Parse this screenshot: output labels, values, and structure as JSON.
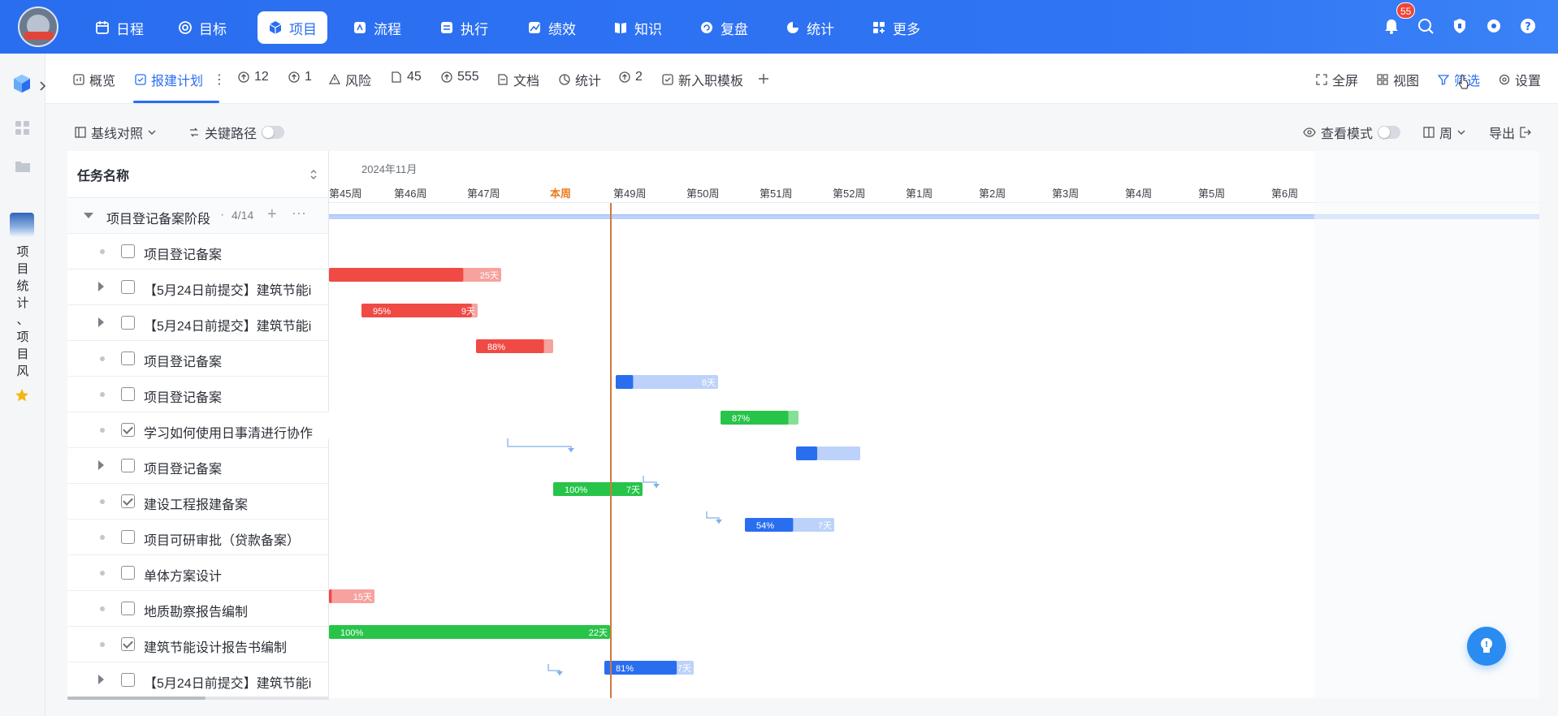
{
  "nav": {
    "items": [
      {
        "label": "日程",
        "icon": "calendar-icon"
      },
      {
        "label": "目标",
        "icon": "target-icon"
      },
      {
        "label": "项目",
        "icon": "cube-icon",
        "active": true
      },
      {
        "label": "流程",
        "icon": "flow-icon"
      },
      {
        "label": "执行",
        "icon": "list-icon"
      },
      {
        "label": "绩效",
        "icon": "chart-icon"
      },
      {
        "label": "知识",
        "icon": "book-icon"
      },
      {
        "label": "复盘",
        "icon": "review-icon"
      },
      {
        "label": "统计",
        "icon": "pie-icon"
      },
      {
        "label": "更多",
        "icon": "grid-plus-icon"
      }
    ],
    "notification_count": "55"
  },
  "rail": {
    "project_name": "项目统计、项目风"
  },
  "tabs": {
    "items": [
      {
        "label": "概览"
      },
      {
        "label": "报建计划",
        "active": true
      },
      {
        "label": "12"
      },
      {
        "label": "1"
      },
      {
        "label": "风险"
      },
      {
        "label": "45"
      },
      {
        "label": "555"
      },
      {
        "label": "文档"
      },
      {
        "label": "统计"
      },
      {
        "label": "2"
      },
      {
        "label": "新入职模板"
      }
    ],
    "right": {
      "fullscreen": "全屏",
      "view": "视图",
      "filter": "筛选",
      "settings": "设置"
    }
  },
  "toolbar": {
    "baseline": "基线对照",
    "critical_path": "关键路径",
    "view_mode": "查看模式",
    "scale": "周",
    "export": "导出"
  },
  "tasklist": {
    "header": "任务名称",
    "group": {
      "name": "项目登记备案阶段",
      "count": "4/14"
    },
    "rows": [
      {
        "name": "项目登记备案",
        "expand": false,
        "checked": false
      },
      {
        "name": "【5月24日前提交】建筑节能i",
        "expand": true,
        "checked": false
      },
      {
        "name": "【5月24日前提交】建筑节能i",
        "expand": true,
        "checked": false
      },
      {
        "name": "项目登记备案",
        "expand": false,
        "checked": false
      },
      {
        "name": "项目登记备案",
        "expand": false,
        "checked": false
      },
      {
        "name": "学习如何使用日事清进行协作",
        "expand": false,
        "checked": true
      },
      {
        "name": "项目登记备案",
        "expand": true,
        "checked": false
      },
      {
        "name": "建设工程报建备案",
        "expand": false,
        "checked": true
      },
      {
        "name": "项目可研审批（贷款备案）",
        "expand": false,
        "checked": false
      },
      {
        "name": "单体方案设计",
        "expand": false,
        "checked": false
      },
      {
        "name": "地质勘察报告编制",
        "expand": false,
        "checked": false
      },
      {
        "name": "建筑节能设计报告书编制",
        "expand": false,
        "checked": true
      },
      {
        "name": "【5月24日前提交】建筑节能i",
        "expand": true,
        "checked": false
      }
    ]
  },
  "gantt": {
    "month": "2024年11月",
    "weeks": [
      "第45周",
      "第46周",
      "第47周",
      "本周",
      "第49周",
      "第50周",
      "第51周",
      "第52周",
      "第1周",
      "第2周",
      "第3周",
      "第4周",
      "第5周",
      "第6周"
    ],
    "bars": [
      {
        "row": 1,
        "color": "red",
        "progress_label": "",
        "duration_label": "25天"
      },
      {
        "row": 2,
        "color": "red",
        "progress_label": "95%",
        "duration_label": "9天"
      },
      {
        "row": 3,
        "color": "red",
        "progress_label": "88%",
        "duration_label": ""
      },
      {
        "row": 4,
        "color": "blue",
        "progress_label": "",
        "duration_label": "8天"
      },
      {
        "row": 5,
        "color": "green",
        "progress_label": "87%",
        "duration_label": ""
      },
      {
        "row": 6,
        "color": "blue",
        "progress_label": "",
        "duration_label": ""
      },
      {
        "row": 7,
        "color": "green",
        "progress_label": "100%",
        "duration_label": "7天"
      },
      {
        "row": 8,
        "color": "blue",
        "progress_label": "54%",
        "duration_label": "7天"
      },
      {
        "row": 10,
        "color": "red",
        "progress_label": "",
        "duration_label": "15天"
      },
      {
        "row": 11,
        "color": "green",
        "progress_label": "100%",
        "duration_label": "22天"
      },
      {
        "row": 12,
        "color": "blue",
        "progress_label": "81%",
        "duration_label": "7天"
      }
    ]
  },
  "colors": {
    "primary": "#2a6ef0",
    "red": "#f04a45",
    "red_light": "#f7a29f",
    "green": "#28c44a",
    "green_light": "#86df97",
    "blue": "#2a6ef0",
    "blue_light": "#bcd2fa",
    "today": "#d07a3b"
  }
}
